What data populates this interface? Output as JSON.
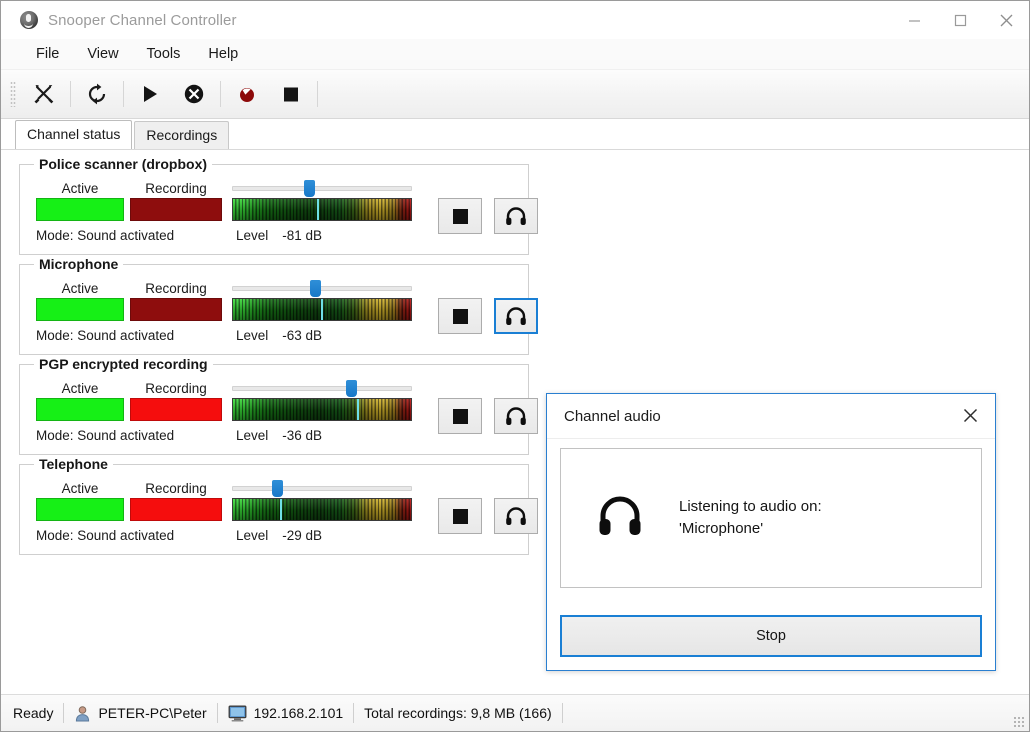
{
  "window": {
    "title": "Snooper Channel Controller",
    "icon": "microphone-logo-icon",
    "controls": {
      "minimize": "minimize-icon",
      "maximize": "maximize-icon",
      "close": "close-icon"
    }
  },
  "menubar": {
    "items": [
      {
        "label": "File"
      },
      {
        "label": "View"
      },
      {
        "label": "Tools"
      },
      {
        "label": "Help"
      }
    ]
  },
  "toolbar": {
    "buttons": [
      {
        "name": "settings-tools-icon",
        "tooltip": "Settings"
      },
      {
        "name": "refresh-icon",
        "tooltip": "Refresh"
      },
      {
        "name": "play-icon",
        "tooltip": "Start"
      },
      {
        "name": "stop-all-icon",
        "tooltip": "Stop all"
      },
      {
        "name": "record-icon",
        "tooltip": "Record"
      },
      {
        "name": "stop-icon",
        "tooltip": "Stop"
      }
    ]
  },
  "tabs": [
    {
      "label": "Channel status",
      "active": true
    },
    {
      "label": "Recordings",
      "active": false
    }
  ],
  "labels": {
    "active": "Active",
    "recording": "Recording",
    "level": "Level",
    "stop_button_icon": "stop-icon",
    "listen_button_icon": "headphones-icon"
  },
  "channels": [
    {
      "title": "Police scanner (dropbox)",
      "active": true,
      "recording": false,
      "recording_color": "#8e0d0d",
      "active_color": "#16f016",
      "mode": "Mode: Sound activated",
      "level": "-81 dB",
      "slider_percent": 43,
      "meter_marker_percent": 48,
      "listening": false
    },
    {
      "title": "Microphone",
      "active": true,
      "recording": false,
      "recording_color": "#8e0d0d",
      "active_color": "#16f016",
      "mode": "Mode: Sound activated",
      "level": "-63 dB",
      "slider_percent": 46,
      "meter_marker_percent": 50,
      "listening": true
    },
    {
      "title": "PGP encrypted recording",
      "active": true,
      "recording": true,
      "recording_color": "#f50d0d",
      "active_color": "#16f016",
      "mode": "Mode: Sound activated",
      "level": "-36 dB",
      "slider_percent": 66,
      "meter_marker_percent": 70,
      "listening": false
    },
    {
      "title": "Telephone",
      "active": true,
      "recording": true,
      "recording_color": "#f50d0d",
      "active_color": "#16f016",
      "mode": "Mode: Sound activated",
      "level": "-29 dB",
      "slider_percent": 25,
      "meter_marker_percent": 27,
      "listening": false
    }
  ],
  "dialog": {
    "title": "Channel audio",
    "close_icon": "close-icon",
    "icon": "headphones-icon",
    "message_line1": "Listening to audio on:",
    "message_line2": "'Microphone'",
    "stop_label": "Stop"
  },
  "statusbar": {
    "ready": "Ready",
    "user_icon": "user-icon",
    "user": "PETER-PC\\Peter",
    "computer_icon": "monitor-icon",
    "address": "192.168.2.101",
    "recordings": "Total recordings: 9,8 MB (166)"
  },
  "colors": {
    "accent": "#1a7fd4",
    "active_green": "#16f016",
    "recording_red": "#f50d0d",
    "recording_idle_red": "#8e0d0d",
    "meter_marker": "#6fe0e8"
  }
}
